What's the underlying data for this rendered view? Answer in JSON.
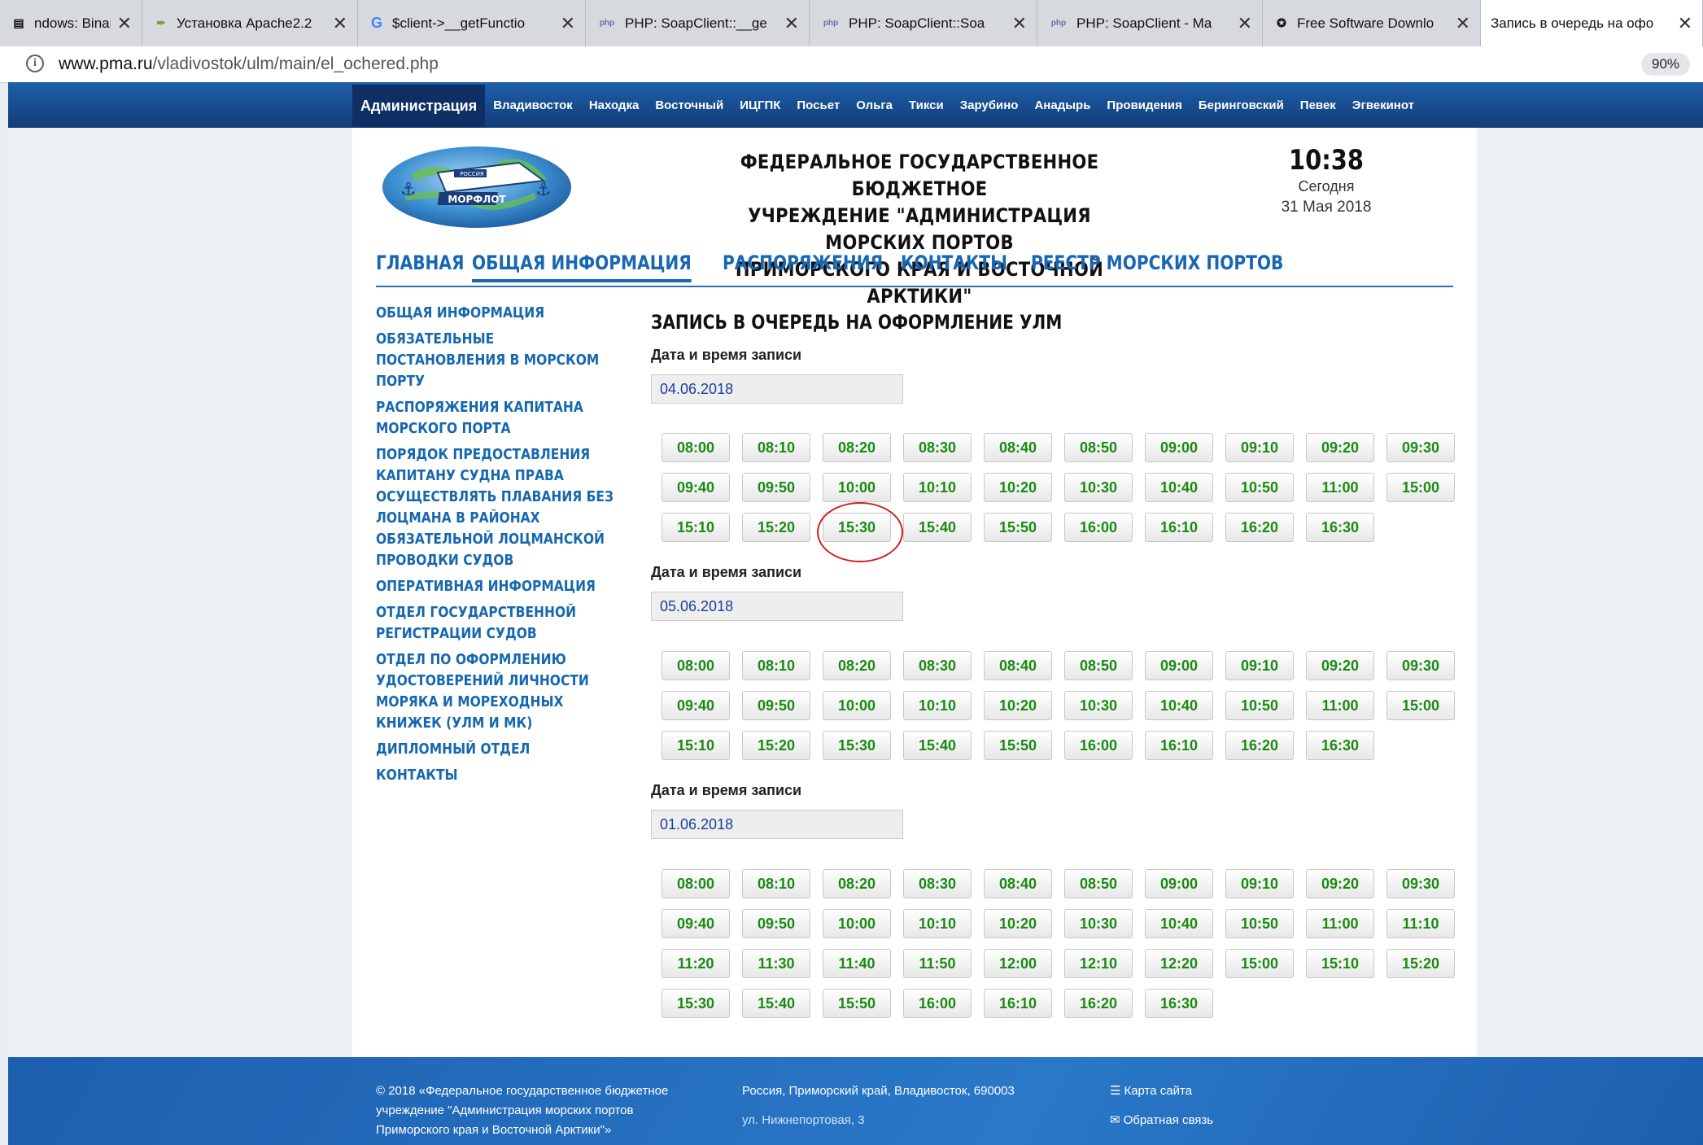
{
  "browser": {
    "tabs": [
      {
        "label": "ndows: Binaric",
        "icon": "windows-doc-icon"
      },
      {
        "label": "Установка Apache2.2",
        "icon": "apache-feather-icon"
      },
      {
        "label": "$client->__getFunctio",
        "icon": "google-g-icon"
      },
      {
        "label": "PHP: SoapClient::__ge",
        "icon": "php-icon"
      },
      {
        "label": "PHP: SoapClient::Soa",
        "icon": "php-icon"
      },
      {
        "label": "PHP: SoapClient - Ma",
        "icon": "php-icon"
      },
      {
        "label": "Free Software Downlo",
        "icon": "software-icon"
      },
      {
        "label": "Запись в очередь на офо",
        "icon": "none",
        "active": true
      }
    ],
    "url_domain": "www.pma.ru",
    "url_path": "/vladivostok/ulm/main/el_ochered.php",
    "zoom": "90%"
  },
  "site": {
    "topnav": [
      "Администрация",
      "Владивосток",
      "Находка",
      "Восточный",
      "ИЦГПК",
      "Посьет",
      "Ольга",
      "Тикси",
      "Зарубино",
      "Анадырь",
      "Провидения",
      "Беринговский",
      "Певек",
      "Эгвекинот"
    ],
    "logo_top": "РОССИЯ",
    "logo_main": "МОРФЛОТ",
    "org_title": [
      "ФЕДЕРАЛЬНОЕ ГОСУДАРСТВЕННОЕ БЮДЖЕТНОЕ",
      "УЧРЕЖДЕНИЕ \"АДМИНИСТРАЦИЯ МОРСКИХ ПОРТОВ",
      "ПРИМОРСКОГО КРАЯ И ВОСТОЧНОЙ АРКТИКИ\""
    ],
    "clock": {
      "time": "10:38",
      "today": "Сегодня",
      "date": "31 Мая 2018"
    },
    "main_menu": [
      "ГЛАВНАЯ",
      "ОБЩАЯ ИНФОРМАЦИЯ",
      "РАСПОРЯЖЕНИЯ",
      "КОНТАКТЫ",
      "РЕЕСТР МОРСКИХ ПОРТОВ"
    ],
    "sidebar": [
      "ОБЩАЯ ИНФОРМАЦИЯ",
      "ОБЯЗАТЕЛЬНЫЕ ПОСТАНОВЛЕНИЯ В МОРСКОМ ПОРТУ",
      "РАСПОРЯЖЕНИЯ КАПИТАНА МОРСКОГО ПОРТА",
      "ПОРЯДОК ПРЕДОСТАВЛЕНИЯ КАПИТАНУ СУДНА ПРАВА ОСУЩЕСТВЛЯТЬ ПЛАВАНИЯ БЕЗ ЛОЦМАНА В РАЙОНАХ ОБЯЗАТЕЛЬНОЙ ЛОЦМАНСКОЙ ПРОВОДКИ СУДОВ",
      "ОПЕРАТИВНАЯ ИНФОРМАЦИЯ",
      "ОТДЕЛ ГОСУДАРСТВЕННОЙ РЕГИСТРАЦИИ СУДОВ",
      "ОТДЕЛ ПО ОФОРМЛЕНИЮ УДОСТОВЕРЕНИЙ ЛИЧНОСТИ МОРЯКА И МОРЕХОДНЫХ КНИЖЕК (УЛМ И МК)",
      "ДИПЛОМНЫЙ ОТДЕЛ",
      "КОНТАКТЫ"
    ],
    "page_title": "ЗАПИСЬ В ОЧЕРЕДЬ НА ОФОРМЛЕНИЕ УЛМ",
    "sections": [
      {
        "label": "Дата и время записи",
        "date": "04.06.2018",
        "slots": [
          "08:00",
          "08:10",
          "08:20",
          "08:30",
          "08:40",
          "08:50",
          "09:00",
          "09:10",
          "09:20",
          "09:30",
          "09:40",
          "09:50",
          "10:00",
          "10:10",
          "10:20",
          "10:30",
          "10:40",
          "10:50",
          "11:00",
          "15:00",
          "15:10",
          "15:20",
          "15:30",
          "15:40",
          "15:50",
          "16:00",
          "16:10",
          "16:20",
          "16:30"
        ]
      },
      {
        "label": "Дата и время записи",
        "date": "05.06.2018",
        "slots": [
          "08:00",
          "08:10",
          "08:20",
          "08:30",
          "08:40",
          "08:50",
          "09:00",
          "09:10",
          "09:20",
          "09:30",
          "09:40",
          "09:50",
          "10:00",
          "10:10",
          "10:20",
          "10:30",
          "10:40",
          "10:50",
          "11:00",
          "15:00",
          "15:10",
          "15:20",
          "15:30",
          "15:40",
          "15:50",
          "16:00",
          "16:10",
          "16:20",
          "16:30"
        ]
      },
      {
        "label": "Дата и время записи",
        "date": "01.06.2018",
        "slots": [
          "08:00",
          "08:10",
          "08:20",
          "08:30",
          "08:40",
          "08:50",
          "09:00",
          "09:10",
          "09:20",
          "09:30",
          "09:40",
          "09:50",
          "10:00",
          "10:10",
          "10:20",
          "10:30",
          "10:40",
          "10:50",
          "11:00",
          "11:10",
          "11:20",
          "11:30",
          "11:40",
          "11:50",
          "12:00",
          "12:10",
          "12:20",
          "15:00",
          "15:10",
          "15:20",
          "15:30",
          "15:40",
          "15:50",
          "16:00",
          "16:10",
          "16:20",
          "16:30"
        ]
      }
    ],
    "footer": {
      "copyright": [
        "© 2018 «Федеральное государственное бюджетное",
        "учреждение \"Администрация морских портов",
        "Приморского края и Восточной Арктики\"»"
      ],
      "address": [
        "Россия, Приморский край, Владивосток, 690003",
        "ул. Нижнепортовая, 3"
      ],
      "sitemap": "Карта сайта",
      "feedback": "Обратная связь"
    }
  }
}
